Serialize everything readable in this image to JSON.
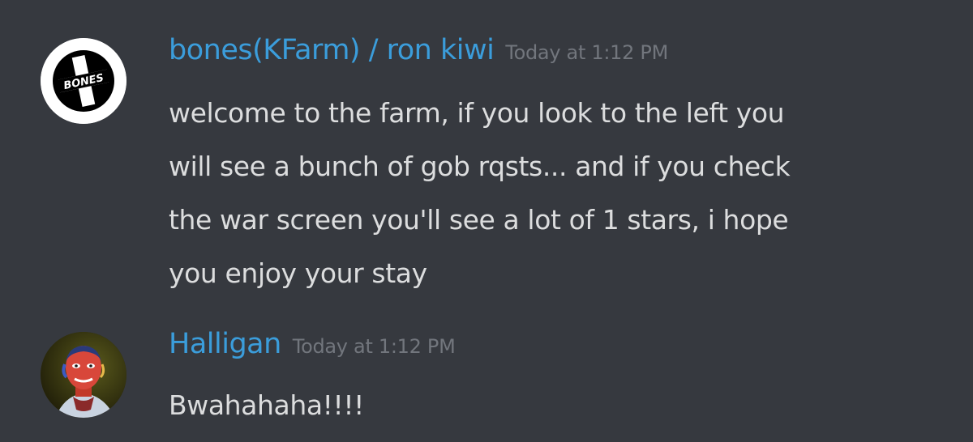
{
  "messages": [
    {
      "avatar": {
        "icon": "bones-logo-icon",
        "text": "BONES",
        "background": "#ffffff"
      },
      "username": "bones(KFarm) / ron kiwi",
      "timestamp": "Today at 1:12 PM",
      "lines": [
        "welcome to the farm, if you look to the left you",
        "will see a bunch of gob rqsts... and if you check",
        "the war screen you'll see a lot of 1 stars, i hope",
        "you enjoy your stay"
      ]
    },
    {
      "avatar": {
        "icon": "user-photo-icon"
      },
      "username": "Halligan",
      "timestamp": "Today at 1:12 PM",
      "lines": [
        "Bwahahaha!!!!"
      ]
    }
  ],
  "colors": {
    "background": "#36393f",
    "username": "#3b9ddb",
    "timestamp": "#72767d",
    "message_text": "#dcddde"
  }
}
